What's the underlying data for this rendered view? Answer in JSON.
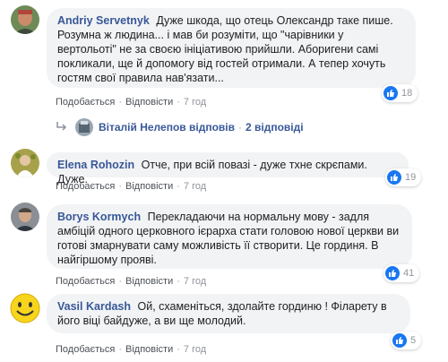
{
  "comments": [
    {
      "author": "Andriy Servetnyk",
      "text": "Дуже шкода, що отець Олександр таке пише. Розумна ж людина... і мав би розуміти, що \"чарівники у вертольоті\" не за своєю ініціативою прийшли. Аборигени самі покликали, ще й допомогу від гостей отримали. А тепер хочуть гостям свої правила нав'язати...",
      "like_label": "Подобається",
      "reply_label": "Відповісти",
      "time": "7 год",
      "reactions": "18"
    },
    {
      "author": "Elena Rohozin",
      "text": "Отче, при всій повазі - дуже тхне скрєпами. Дуже.",
      "like_label": "Подобається",
      "reply_label": "Відповісти",
      "time": "7 год",
      "reactions": "19"
    },
    {
      "author": "Borys Kormych",
      "text": "Перекладаючи на нормальну мову - задля амбіцій одного церковного ієрарха стати головою нової церкви ви готові змарнувати саму можливість її створити. Це гординя. В найгіршому прояві.",
      "like_label": "Подобається",
      "reply_label": "Відповісти",
      "time": "7 год",
      "reactions": "41"
    },
    {
      "author": "Vasil Kardash",
      "text": "Ой, схаменіться, здолайте гординю ! Філарету в його віці байдуже, а ви ще молодий.",
      "like_label": "Подобається",
      "reply_label": "Відповісти",
      "time": "7 год",
      "reactions": "5"
    }
  ],
  "replies": {
    "replier": "Віталій Нелепов відповів",
    "count_label": "2 відповіді"
  },
  "colors": {
    "author": "#385898",
    "bubble": "#f2f3f5",
    "like": "#1877f2"
  }
}
